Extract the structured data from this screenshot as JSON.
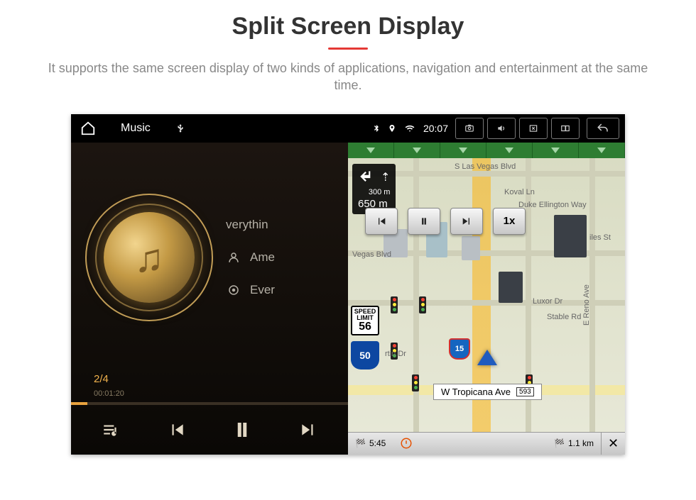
{
  "header": {
    "title": "Split Screen Display",
    "description": "It supports the same screen display of two kinds of applications, navigation and entertainment at the same time."
  },
  "statusbar": {
    "app": "Music",
    "time": "20:07"
  },
  "music": {
    "tracks": {
      "prev": "verythin",
      "current": "Ame",
      "next": "Ever"
    },
    "index": "2/4",
    "elapsed": "00:01:20"
  },
  "nav": {
    "turn": {
      "dist_small": "300 m",
      "dist_big": "650 m"
    },
    "speed_limit": {
      "label": "SPEED LIMIT",
      "value": "56"
    },
    "state_route": "50",
    "interstate": "15",
    "speed_mult": "1x",
    "banner": {
      "street": "W Tropicana Ave",
      "exit": "593"
    },
    "bottom": {
      "eta": "5:45",
      "dist": "1.1 km"
    },
    "streets": {
      "top": "S Las Vegas Blvd",
      "koval": "Koval Ln",
      "duke": "Duke Ellington Way",
      "iles": "iles St",
      "vegas": "Vegas Blvd",
      "luxor": "Luxor Dr",
      "stable": "Stable Rd",
      "reno": "E Reno Ave",
      "martin": "rtin Dr"
    }
  }
}
